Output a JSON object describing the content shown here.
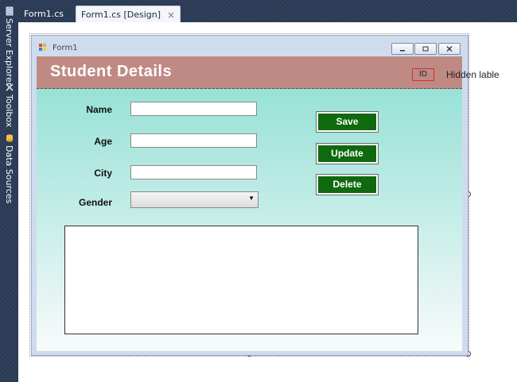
{
  "dock": {
    "items": [
      {
        "label": "Server Explorer",
        "icon": "server-explorer-icon"
      },
      {
        "label": "Toolbox",
        "icon": "toolbox-icon"
      },
      {
        "label": "Data Sources",
        "icon": "data-sources-icon"
      }
    ]
  },
  "tabs": [
    {
      "label": "Form1.cs",
      "active": false
    },
    {
      "label": "Form1.cs [Design]",
      "active": true,
      "close": "×"
    }
  ],
  "form": {
    "title": "Form1",
    "window_buttons": {
      "minimize": "minimize-icon",
      "maximize": "maximize-icon",
      "close": "close-icon"
    },
    "header_title": "Student Details",
    "id_label": "ID",
    "hidden_label": "Hidden lable",
    "fields": {
      "name_label": "Name",
      "age_label": "Age",
      "city_label": "City",
      "gender_label": "Gender",
      "name_value": "",
      "age_value": "",
      "city_value": "",
      "gender_value": ""
    },
    "buttons": {
      "save": "Save",
      "update": "Update",
      "delete": "Delete"
    }
  },
  "colors": {
    "header_bg": "#c08a84",
    "button_bg": "#0f6a0f",
    "client_gradient_top": "#8ddfd2",
    "dock_bg": "#2b3a55"
  }
}
